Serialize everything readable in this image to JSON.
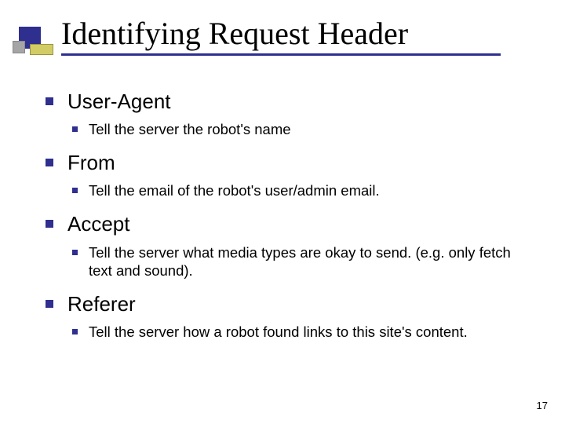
{
  "title": "Identifying Request Header",
  "items": [
    {
      "label": "User-Agent",
      "desc": "Tell the server the robot's name"
    },
    {
      "label": "From",
      "desc": "Tell the email of the robot's user/admin email."
    },
    {
      "label": "Accept",
      "desc": "Tell the server what media types are okay to send. (e.g. only fetch text and sound)."
    },
    {
      "label": "Referer",
      "desc": "Tell the server how a robot found links to this site's content."
    }
  ],
  "page_number": "17"
}
